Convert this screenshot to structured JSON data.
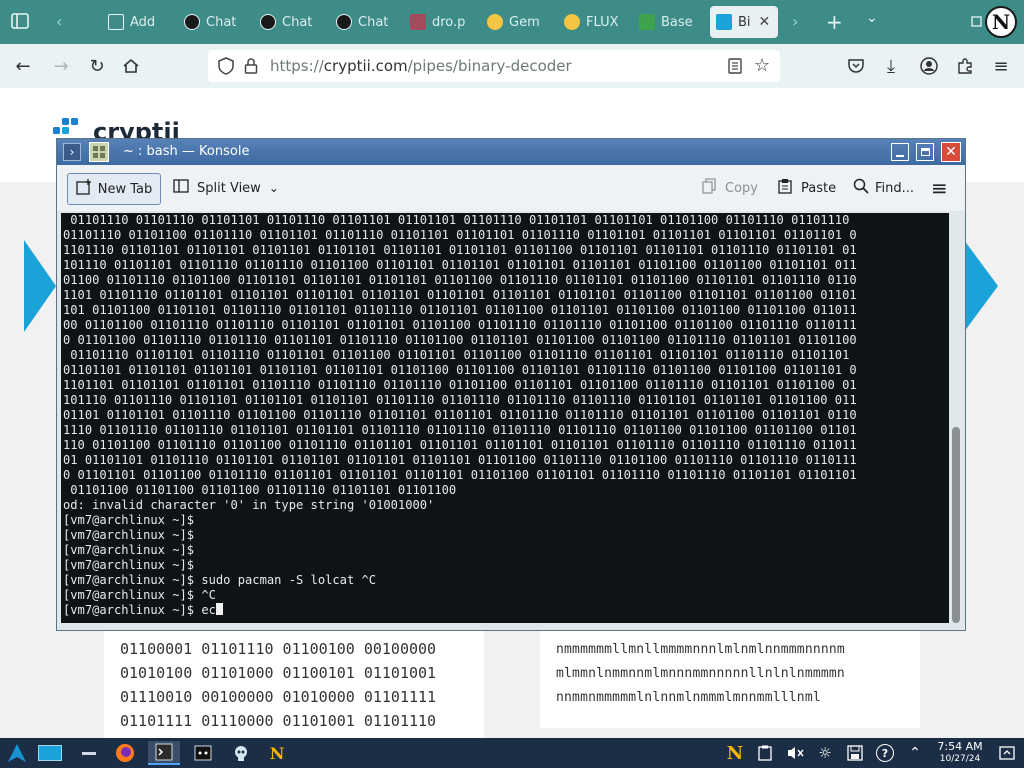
{
  "browser": {
    "tabs": [
      {
        "label": "Add",
        "color": "#ffffff"
      },
      {
        "label": "Chat",
        "color": "#1a1a1a"
      },
      {
        "label": "Chat",
        "color": "#1a1a1a"
      },
      {
        "label": "Chat",
        "color": "#1a1a1a"
      },
      {
        "label": "dro.p",
        "color": "#a44b5c"
      },
      {
        "label": "Gem",
        "color": "#f4c542"
      },
      {
        "label": "FLUX",
        "color": "#f4c542"
      },
      {
        "label": "Base",
        "color": "#3fa34d"
      },
      {
        "label": "Bi",
        "color": "#1aa3d9"
      }
    ],
    "url_prefix": "https://",
    "url_domain": "cryptii.com",
    "url_path": "/pipes/binary-decoder",
    "profile_letter": "N"
  },
  "site": {
    "logo_text": "cryptii",
    "binary_lines": [
      "01100001 01101110 01100100 00100000",
      "01010100 01101000 01100101 01101001",
      "01110010 00100000 01010000 01101111",
      "01101111 01110000 01101001 01101110"
    ],
    "text_lines": [
      "nmmmmmmllmnllmmmmnnnlmlnmlnnmmmnnnnm",
      "mlmmnlnmmnnmlmnnnmmnnnnnllnlnlnmmmmn",
      "nnmmnmmmmmlnlnnmlnmmmlmnnmmlllnml"
    ]
  },
  "konsole": {
    "title": "~ : bash — Konsole",
    "toolbar": {
      "new_tab": "New Tab",
      "split_view": "Split View",
      "copy": "Copy",
      "paste": "Paste",
      "find": "Find..."
    },
    "terminal_output": " 01101110 01101110 01101101 01101110 01101101 01101101 01101110 01101101 01101101 01101100 01101110 01101110\n01101110 01101100 01101110 01101101 01101110 01101101 01101101 01101110 01101101 01101101 01101101 01101101 0\n1101110 01101101 01101101 01101101 01101101 01101101 01101101 01101100 01101101 01101101 01101110 01101101 01\n101110 01101101 01101110 01101110 01101100 01101101 01101101 01101101 01101101 01101100 01101100 01101101 011\n01100 01101110 01101100 01101101 01101101 01101101 01101100 01101110 01101101 01101100 01101101 01101110 0110\n1101 01101110 01101101 01101101 01101101 01101101 01101101 01101101 01101101 01101100 01101101 01101100 01101\n101 01101100 01101101 01101110 01101101 01101110 01101101 01101100 01101101 01101100 01101100 01101100 011011\n00 01101100 01101110 01101110 01101101 01101101 01101100 01101110 01101110 01101100 01101100 01101110 0110111\n0 01101100 01101110 01101110 01101101 01101110 01101100 01101101 01101100 01101100 01101110 01101101 01101100\n 01101110 01101101 01101110 01101101 01101100 01101101 01101100 01101110 01101101 01101101 01101110 01101101\n01101101 01101101 01101101 01101101 01101101 01101100 01101100 01101101 01101110 01101100 01101100 01101101 0\n1101101 01101101 01101101 01101110 01101110 01101110 01101100 01101101 01101100 01101110 01101101 01101100 01\n101110 01101110 01101101 01101101 01101101 01101110 01101110 01101110 01101110 01101101 01101101 01101100 011\n01101 01101101 01101110 01101100 01101110 01101101 01101101 01101110 01101110 01101101 01101100 01101101 0110\n1110 01101110 01101110 01101101 01101101 01101110 01101110 01101110 01101110 01101100 01101100 01101100 01101\n110 01101100 01101110 01101100 01101110 01101101 01101101 01101101 01101101 01101110 01101110 01101110 011011\n01 01101101 01101110 01101101 01101101 01101101 01101101 01101100 01101110 01101100 01101110 01101110 0110111\n0 01101101 01101100 01101110 01101101 01101101 01101101 01101100 01101101 01101110 01101110 01101101 01101101\n 01101100 01101100 01101100 01101110 01101101 01101100\nod: invalid character '0' in type string '01001000'\n[vm7@archlinux ~]$\n[vm7@archlinux ~]$\n[vm7@archlinux ~]$\n[vm7@archlinux ~]$\n[vm7@archlinux ~]$ sudo pacman -S lolcat ^C\n[vm7@archlinux ~]$ ^C\n[vm7@archlinux ~]$ ec"
  },
  "taskbar": {
    "time": "7:54 AM",
    "date": "10/27/24"
  }
}
